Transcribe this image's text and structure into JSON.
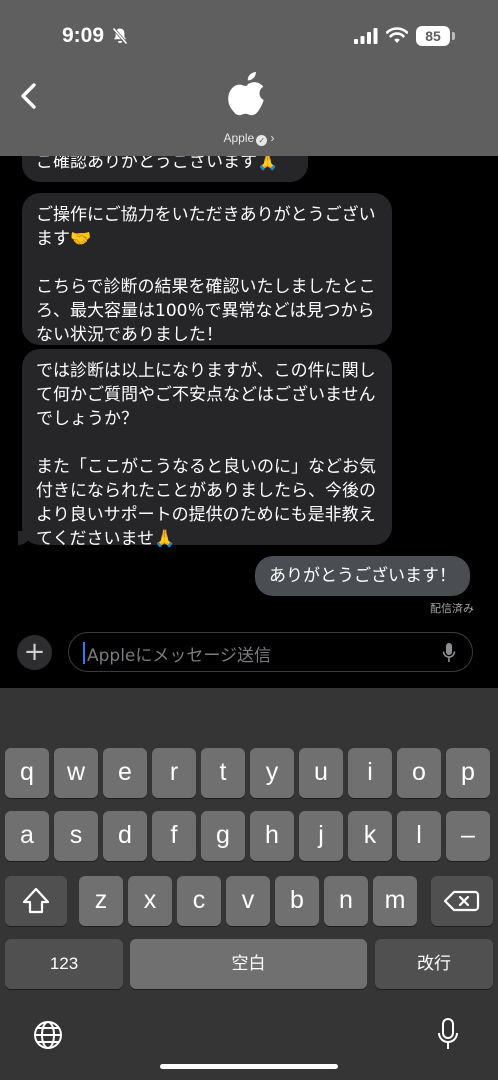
{
  "status_bar": {
    "time": "9:09",
    "battery": "85"
  },
  "header": {
    "contact_name": "Apple"
  },
  "messages": [
    {
      "from": "them",
      "text": "ご確認ありがとうございます🙏"
    },
    {
      "from": "them",
      "text": "ご操作にご協力をいただきありがとうございます🤝\n\nこちらで診断の結果を確認いたしましたところ、最大容量は100％で異常などは見つからない状況でありました！"
    },
    {
      "from": "them",
      "text": "では診断は以上になりますが、この件に関して何かご質問やご不安点などはございませんでしょうか？\n\nまた「ここがこうなると良いのに」などお気付きになられたことがありましたら、今後のより良いサポートの提供のためにも是非教えてくださいませ🙏"
    },
    {
      "from": "me",
      "text": "ありがとうございます！"
    }
  ],
  "delivery_status": "配信済み",
  "composer": {
    "placeholder": "Appleにメッセージ送信"
  },
  "keyboard": {
    "row1": [
      "q",
      "w",
      "e",
      "r",
      "t",
      "y",
      "u",
      "i",
      "o",
      "p"
    ],
    "row2": [
      "a",
      "s",
      "d",
      "f",
      "g",
      "h",
      "j",
      "k",
      "l",
      "–"
    ],
    "row3": [
      "z",
      "x",
      "c",
      "v",
      "b",
      "n",
      "m"
    ],
    "numbers_key": "123",
    "space_key": "空白",
    "return_key": "改行"
  },
  "icons": [
    "bell-slash-icon",
    "signal-icon",
    "wifi-icon",
    "back-chevron-icon",
    "apple-logo-icon",
    "verified-badge-icon",
    "plus-icon",
    "microphone-icon",
    "shift-icon",
    "delete-icon",
    "globe-icon",
    "dictation-icon"
  ]
}
